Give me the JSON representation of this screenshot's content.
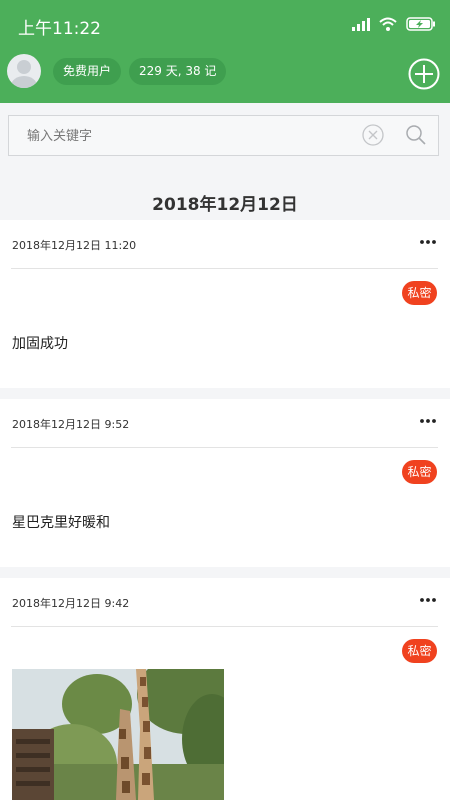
{
  "status_bar": {
    "time": "上午11:22",
    "icons": [
      "signal-icon",
      "wifi-icon",
      "battery-charging-icon"
    ]
  },
  "header": {
    "user_type": "免费用户",
    "stats": "229 天, 38 记",
    "accent_color": "#4caf5a"
  },
  "search": {
    "placeholder": "输入关键字",
    "value": ""
  },
  "date_heading": "2018年12月12日",
  "entries": [
    {
      "time": "2018年12月12日 11:20",
      "badge": "私密",
      "text": "加固成功"
    },
    {
      "time": "2018年12月12日 9:52",
      "badge": "私密",
      "text": "星巴克里好暖和"
    },
    {
      "time": "2018年12月12日 9:42",
      "badge": "私密",
      "image": "giraffe-photo"
    }
  ],
  "badge_color": "#f0421f"
}
